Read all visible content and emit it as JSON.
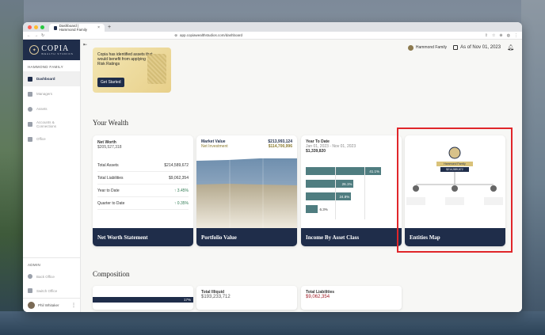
{
  "browser": {
    "tab_title": "Dashboard | Hammond Family",
    "url": "app.copiawealthstudios.com/dashboard"
  },
  "brand": {
    "name": "COPIA",
    "subtitle": "WEALTH STUDIOS"
  },
  "sidebar": {
    "family_label": "HAMMOND FAMILY",
    "items": [
      {
        "label": "Dashboard",
        "icon": "grid-icon",
        "active": true
      },
      {
        "label": "Managers",
        "icon": "id-card-icon",
        "active": false
      },
      {
        "label": "Assets",
        "icon": "globe-icon",
        "active": false
      },
      {
        "label": "Accounts & Connections",
        "icon": "bank-icon",
        "active": false
      },
      {
        "label": "Office",
        "icon": "briefcase-icon",
        "active": false
      }
    ],
    "admin_label": "ADMIN",
    "admin_items": [
      {
        "label": "Back Office",
        "icon": "gear-icon"
      },
      {
        "label": "Switch Office",
        "icon": "swap-icon"
      }
    ],
    "user_name": "Phil Whitaker"
  },
  "topbar": {
    "family": "Hammond Family",
    "date": "As of Nov 01, 2023"
  },
  "alert": {
    "message": "Copia has identified assets that would benefit from applying Risk Ratings",
    "button": "Get Started"
  },
  "your_wealth": {
    "heading": "Your Wealth",
    "net_worth": {
      "title": "Net Worth",
      "value": "$205,527,318",
      "rows": [
        {
          "label": "Total Assets",
          "value": "$214,589,672"
        },
        {
          "label": "Total Liabilities",
          "value": "$9,062,354"
        },
        {
          "label": "Year to Date",
          "value": "↑ 3.45%"
        },
        {
          "label": "Quarter to Date",
          "value": "↑ 0.35%"
        }
      ],
      "footer": "Net Worth Statement"
    },
    "portfolio": {
      "label": "Market Value",
      "value": "$213,993,124",
      "sub_label": "Net Investment",
      "sub_value": "$114,700,996",
      "footer": "Portfolio Value"
    },
    "income": {
      "title": "Year To Date",
      "range": "Jan 01, 2023 - Nov 01, 2023",
      "value": "$1,339,820",
      "footer": "Income By Asset Class"
    },
    "entities": {
      "family_badge": "Hammond Family",
      "badge_value": "$214,589,672",
      "footer": "Entities Map"
    }
  },
  "composition": {
    "heading": "Composition",
    "bar_value": "17%",
    "illiquid_label": "Total Illiquid",
    "illiquid_value": "$193,233,712",
    "liabilities_label": "Total Liabilities",
    "liabilities_value": "$9,062,354"
  },
  "chart_data": {
    "type": "bar",
    "categories": [
      "",
      "",
      "",
      ""
    ],
    "values": [
      41.1,
      26.1,
      24.8,
      6.3
    ],
    "unit": "%",
    "orientation": "horizontal",
    "color": "#4f7d80"
  },
  "colors": {
    "navy": "#1f2d4a",
    "gold": "#e8d08a",
    "teal": "#4f7d80",
    "highlight": "#e0262a"
  }
}
